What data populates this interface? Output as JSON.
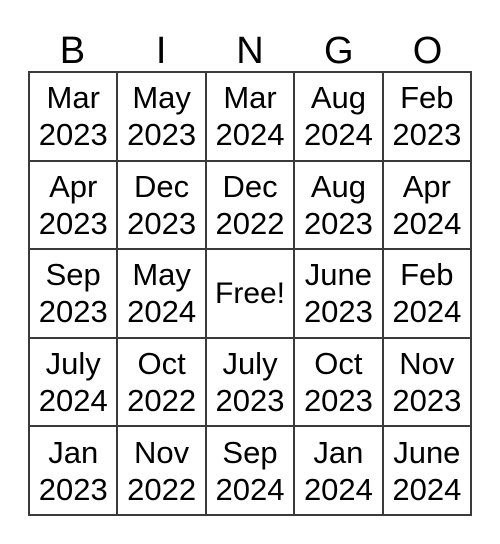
{
  "card": {
    "headers": [
      "B",
      "I",
      "N",
      "G",
      "O"
    ],
    "free_label": "Free!",
    "colors": {
      "background": "#ffffff",
      "text": "#000000",
      "border": "#3a3a3a"
    },
    "rows": [
      [
        {
          "month": "Mar",
          "year": "2023"
        },
        {
          "month": "May",
          "year": "2023"
        },
        {
          "month": "Mar",
          "year": "2024"
        },
        {
          "month": "Aug",
          "year": "2024"
        },
        {
          "month": "Feb",
          "year": "2023"
        }
      ],
      [
        {
          "month": "Apr",
          "year": "2023"
        },
        {
          "month": "Dec",
          "year": "2023"
        },
        {
          "month": "Dec",
          "year": "2022"
        },
        {
          "month": "Aug",
          "year": "2023"
        },
        {
          "month": "Apr",
          "year": "2024"
        }
      ],
      [
        {
          "month": "Sep",
          "year": "2023"
        },
        {
          "month": "May",
          "year": "2024"
        },
        {
          "month": "Free!",
          "year": ""
        },
        {
          "month": "June",
          "year": "2023"
        },
        {
          "month": "Feb",
          "year": "2024"
        }
      ],
      [
        {
          "month": "July",
          "year": "2024"
        },
        {
          "month": "Oct",
          "year": "2022"
        },
        {
          "month": "July",
          "year": "2023"
        },
        {
          "month": "Oct",
          "year": "2023"
        },
        {
          "month": "Nov",
          "year": "2023"
        }
      ],
      [
        {
          "month": "Jan",
          "year": "2023"
        },
        {
          "month": "Nov",
          "year": "2022"
        },
        {
          "month": "Sep",
          "year": "2024"
        },
        {
          "month": "Jan",
          "year": "2024"
        },
        {
          "month": "June",
          "year": "2024"
        }
      ]
    ]
  }
}
